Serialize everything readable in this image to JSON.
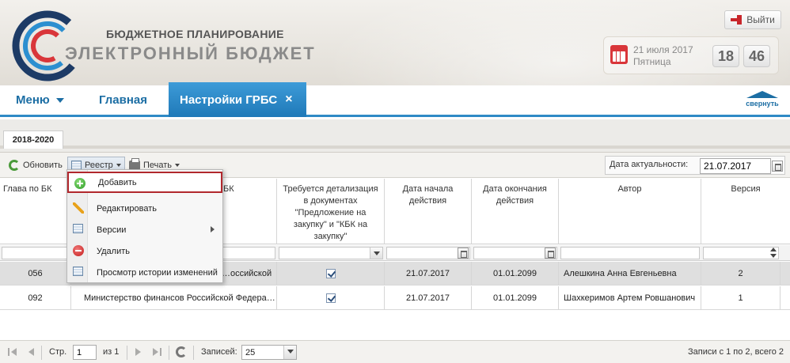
{
  "brand": {
    "line1": "БЮДЖЕТНОЕ ПЛАНИРОВАНИЕ",
    "line2": "ЭЛЕКТРОННЫЙ БЮДЖЕТ"
  },
  "header": {
    "logout_label": "Выйти",
    "date": "21 июля 2017",
    "weekday": "Пятница",
    "clock_hours": "18",
    "clock_minutes": "46"
  },
  "nav": {
    "menu_label": "Меню",
    "home_label": "Главная",
    "active_tab": "Настройки ГРБС",
    "close_symbol": "×",
    "collapse_label": "свернуть"
  },
  "tabs": [
    "2018-2020"
  ],
  "toolbar": {
    "refresh_label": "Обновить",
    "registry_label": "Реестр",
    "print_label": "Печать",
    "actual_date_label": "Дата актуальности:",
    "actual_date_value": "21.07.2017"
  },
  "grid": {
    "columns": [
      "Глава по БК",
      "БК",
      "Требуется детализация в документах \"Предложение на закупку\" и \"КБК на закупку\"",
      "Дата начала действия",
      "Дата окончания действия",
      "Автор",
      "Версия"
    ],
    "rows": [
      {
        "code": "056",
        "name": "…оссийской",
        "flag": true,
        "start": "21.07.2017",
        "end": "01.01.2099",
        "author": "Алешкина Анна Евгеньевна",
        "version": "2"
      },
      {
        "code": "092",
        "name": "Министерство финансов Российской Федера…",
        "flag": true,
        "start": "21.07.2017",
        "end": "01.01.2099",
        "author": "Шахкеримов Артем Ровшанович",
        "version": "1"
      }
    ]
  },
  "menu": {
    "items": [
      {
        "label": "Добавить",
        "icon": "add-icon"
      },
      {
        "label": "Редактировать",
        "icon": "edit-icon"
      },
      {
        "label": "Версии",
        "icon": "versions-icon"
      },
      {
        "label": "Удалить",
        "icon": "delete-icon"
      },
      {
        "label": "Просмотр истории изменений",
        "icon": "history-icon"
      }
    ]
  },
  "pager": {
    "page_label": "Стр.",
    "page_value": "1",
    "of_label": "из 1",
    "records_label": "Записей:",
    "records_value": "25",
    "summary": "Записи с 1 по 2, всего 2"
  },
  "colors": {
    "accent": "#1f79b8",
    "highlight_border": "#b1282d",
    "nav_text": "#1c6ea4"
  }
}
